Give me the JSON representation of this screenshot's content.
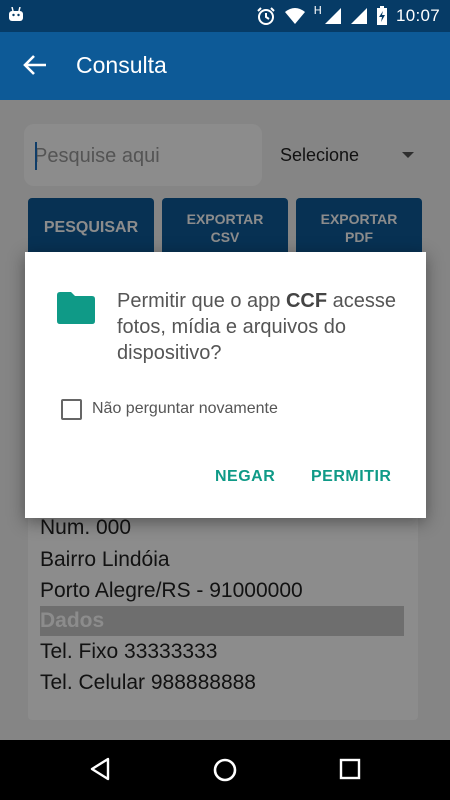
{
  "status_bar": {
    "time": "10:07",
    "network_label": "H",
    "icons": [
      "android-icon",
      "alarm-icon",
      "wifi-icon",
      "signal-icon",
      "battery-charging-icon"
    ]
  },
  "app_bar": {
    "title": "Consulta",
    "back_icon": "arrow-back-icon"
  },
  "search": {
    "placeholder": "Pesquise aqui",
    "value": ""
  },
  "select": {
    "value": "Selecione"
  },
  "buttons": {
    "pesquisar": "PESQUISAR",
    "exportar_csv_line1": "EXPORTAR",
    "exportar_csv_line2": "CSV",
    "exportar_pdf_line1": "EXPORTAR",
    "exportar_pdf_line2": "PDF"
  },
  "result_card": {
    "lines_before": [
      "Num. 000",
      "Bairro Lindóia",
      "Porto Alegre/RS - 91000000"
    ],
    "section_title": "Dados",
    "lines_after": [
      "Tel. Fixo 33333333",
      "Tel. Celular 988888888"
    ]
  },
  "permission_dialog": {
    "message_prefix": "Permitir que o app ",
    "app_name": "CCF",
    "message_suffix": " acesse fotos, mídia e arquivos do dispositivo?",
    "checkbox_label": "Não perguntar novamente",
    "checkbox_checked": false,
    "deny_label": "NEGAR",
    "allow_label": "PERMITIR",
    "accent_color": "#0f9a87",
    "icon": "folder-icon"
  },
  "colors": {
    "status_bar": "#063b66",
    "app_bar": "#0d5a97",
    "button": "#0d5a97"
  }
}
